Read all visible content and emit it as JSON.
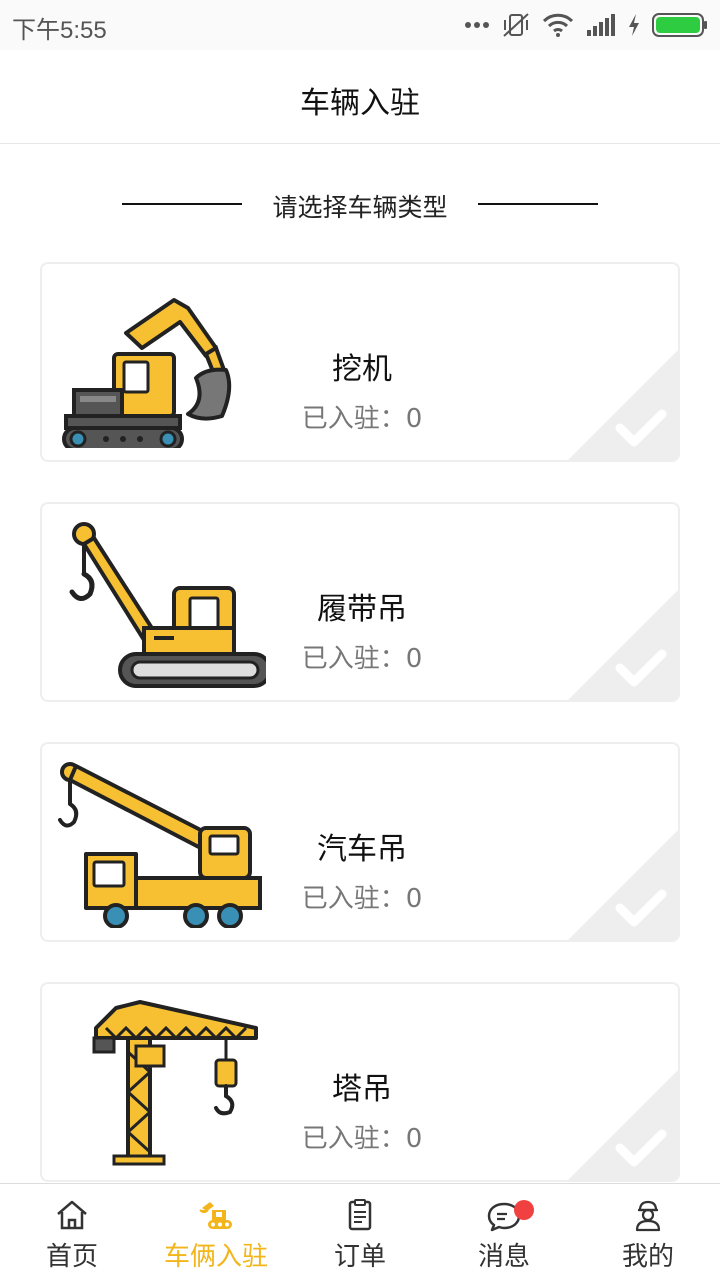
{
  "status_bar": {
    "time": "下午5:55"
  },
  "header": {
    "title": "车辆入驻"
  },
  "section": {
    "heading": "请选择车辆类型"
  },
  "vehicle_types": [
    {
      "name": "挖机",
      "count_text": "已入驻：0",
      "icon": "excavator-icon"
    },
    {
      "name": "履带吊",
      "count_text": "已入驻：0",
      "icon": "crawler-crane-icon"
    },
    {
      "name": "汽车吊",
      "count_text": "已入驻：0",
      "icon": "truck-crane-icon"
    },
    {
      "name": "塔吊",
      "count_text": "已入驻：0",
      "icon": "tower-crane-icon"
    }
  ],
  "bottom_nav": {
    "items": [
      {
        "label": "首页",
        "icon": "home-icon",
        "active": false
      },
      {
        "label": "车俩入驻",
        "icon": "excavator-icon",
        "active": true
      },
      {
        "label": "订单",
        "icon": "clipboard-icon",
        "active": false
      },
      {
        "label": "消息",
        "icon": "chat-icon",
        "active": false,
        "badge": true
      },
      {
        "label": "我的",
        "icon": "user-icon",
        "active": false
      }
    ]
  },
  "colors": {
    "accent": "#f2b61c",
    "badge": "#f04040",
    "check_bg": "#eeeeee"
  }
}
